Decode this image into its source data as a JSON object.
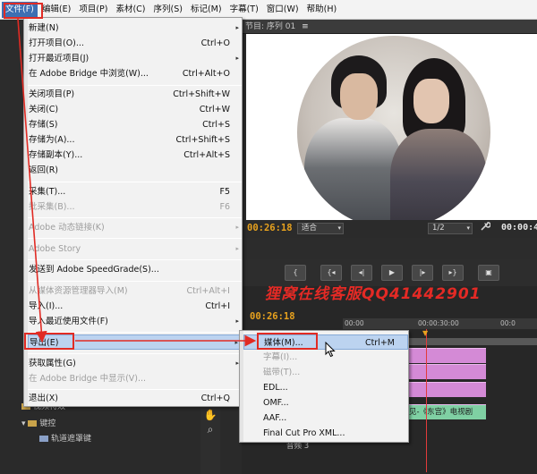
{
  "menubar": {
    "items": [
      "文件(F)",
      "编辑(E)",
      "项目(P)",
      "素材(C)",
      "序列(S)",
      "标记(M)",
      "字幕(T)",
      "窗口(W)",
      "帮助(H)"
    ]
  },
  "monitor": {
    "tab_label": "节目: 序列 01",
    "tab_close": "≡",
    "timecode_left": "00:26:18",
    "fit_label": "适合",
    "quality_label": "1/2",
    "timecode_right": "00:00:4"
  },
  "timeline": {
    "timecode": "00:26:18",
    "ruler_ticks": [
      "00:00",
      "00:00:30:00",
      "00:0"
    ],
    "label_clip": "见-《东宫》电视剧",
    "audio_track": "音频 3"
  },
  "project": {
    "rows": [
      "视频特效",
      "键控",
      "轨道遮罩键"
    ]
  },
  "watermark": "狸窝在线客服QQ41442901",
  "file_menu": {
    "items": [
      {
        "label": "新建(N)",
        "shortcut": "",
        "submenu": true,
        "disabled": false
      },
      {
        "label": "打开项目(O)...",
        "shortcut": "Ctrl+O",
        "submenu": false,
        "disabled": false
      },
      {
        "label": "打开最近项目(J)",
        "shortcut": "",
        "submenu": true,
        "disabled": false
      },
      {
        "label": "在 Adobe Bridge 中浏览(W)...",
        "shortcut": "Ctrl+Alt+O",
        "submenu": false,
        "disabled": false
      },
      {
        "label": "关闭项目(P)",
        "shortcut": "Ctrl+Shift+W",
        "submenu": false,
        "disabled": false
      },
      {
        "label": "关闭(C)",
        "shortcut": "Ctrl+W",
        "submenu": false,
        "disabled": false
      },
      {
        "label": "存储(S)",
        "shortcut": "Ctrl+S",
        "submenu": false,
        "disabled": false
      },
      {
        "label": "存储为(A)...",
        "shortcut": "Ctrl+Shift+S",
        "submenu": false,
        "disabled": false
      },
      {
        "label": "存储副本(Y)...",
        "shortcut": "Ctrl+Alt+S",
        "submenu": false,
        "disabled": false
      },
      {
        "label": "返回(R)",
        "shortcut": "",
        "submenu": false,
        "disabled": false
      },
      {
        "label": "采集(T)...",
        "shortcut": "F5",
        "submenu": false,
        "disabled": false
      },
      {
        "label": "批采集(B)...",
        "shortcut": "F6",
        "submenu": false,
        "disabled": true
      },
      {
        "label": "Adobe 动态链接(K)",
        "shortcut": "",
        "submenu": true,
        "disabled": true
      },
      {
        "label": "Adobe Story",
        "shortcut": "",
        "submenu": true,
        "disabled": true
      },
      {
        "label": "发送到 Adobe SpeedGrade(S)...",
        "shortcut": "",
        "submenu": false,
        "disabled": false
      },
      {
        "label": "从媒体资源管理器导入(M)",
        "shortcut": "Ctrl+Alt+I",
        "submenu": false,
        "disabled": true
      },
      {
        "label": "导入(I)...",
        "shortcut": "Ctrl+I",
        "submenu": false,
        "disabled": false
      },
      {
        "label": "导入最近使用文件(F)",
        "shortcut": "",
        "submenu": true,
        "disabled": false
      },
      {
        "label": "导出(E)",
        "shortcut": "",
        "submenu": true,
        "disabled": false
      },
      {
        "label": "获取属性(G)",
        "shortcut": "",
        "submenu": true,
        "disabled": false
      },
      {
        "label": "在 Adobe Bridge 中显示(V)...",
        "shortcut": "",
        "submenu": false,
        "disabled": true
      },
      {
        "label": "退出(X)",
        "shortcut": "Ctrl+Q",
        "submenu": false,
        "disabled": false
      }
    ]
  },
  "export_menu": {
    "items": [
      {
        "label": "媒体(M)...",
        "shortcut": "Ctrl+M",
        "disabled": false
      },
      {
        "label": "字幕(I)...",
        "shortcut": "",
        "disabled": true
      },
      {
        "label": "磁带(T)...",
        "shortcut": "",
        "disabled": true
      },
      {
        "label": "EDL...",
        "shortcut": "",
        "disabled": false
      },
      {
        "label": "OMF...",
        "shortcut": "",
        "disabled": false
      },
      {
        "label": "AAF...",
        "shortcut": "",
        "disabled": false
      },
      {
        "label": "Final Cut Pro XML...",
        "shortcut": "",
        "disabled": false
      }
    ]
  },
  "icons": {
    "submenu_arrow": "▸",
    "dropdown": "▾",
    "wrench": "🔧"
  },
  "colors": {
    "menubar_active": "#3d6fb3",
    "menu_highlight": "#bcd3f0",
    "annotation_red": "#e12b24",
    "timecode": "#e8a21e",
    "clip_pink": "#d48ad6",
    "clip_green": "#7fd0a3"
  }
}
